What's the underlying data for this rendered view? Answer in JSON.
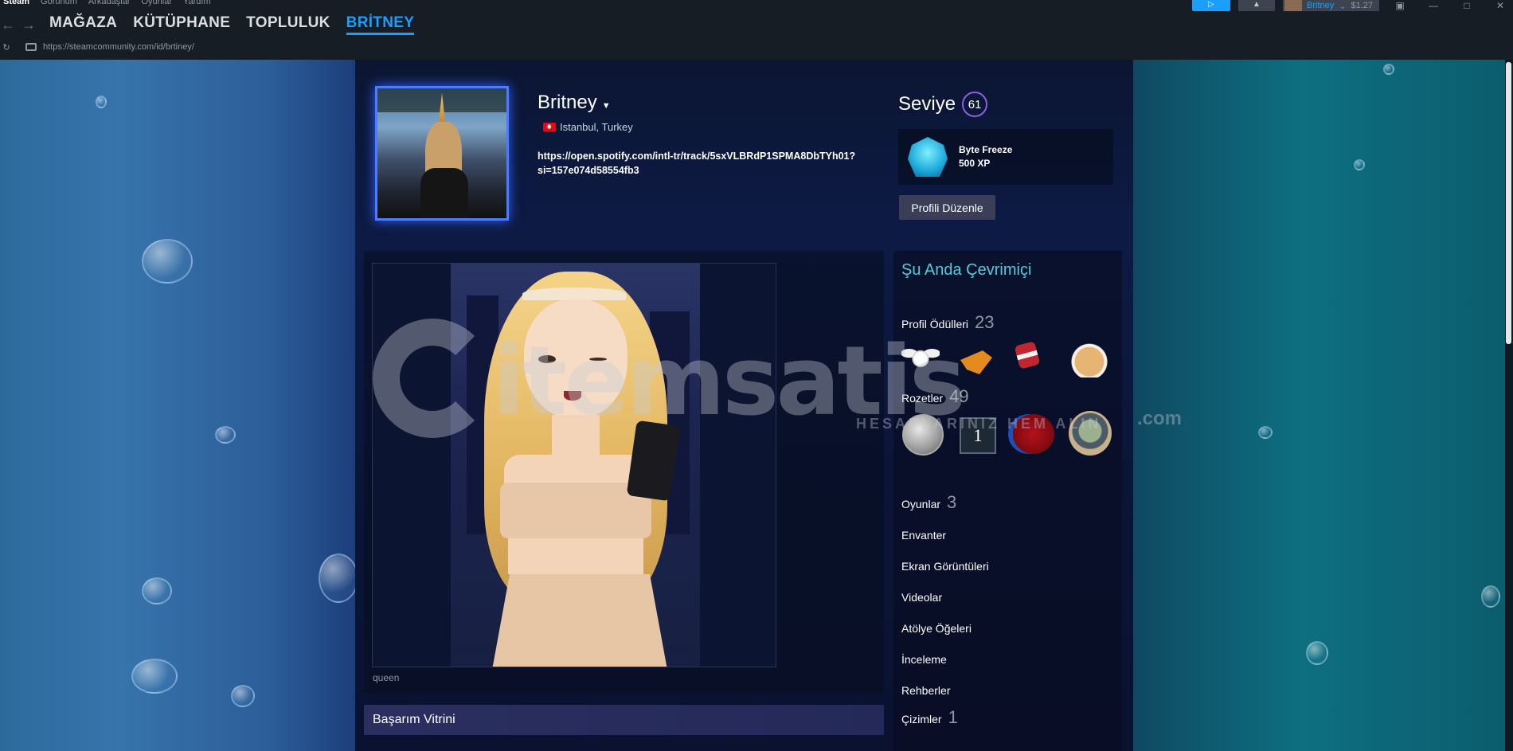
{
  "titlebar": {
    "menu": [
      "Steam",
      "Görünüm",
      "Arkadaşlar",
      "Oyunlar",
      "Yardım"
    ],
    "user_name": "Britney",
    "balance": "$1.27"
  },
  "nav": {
    "back": "←",
    "forward": "→",
    "links": [
      "MAĞAZA",
      "KÜTÜPHANE",
      "TOPLULUK",
      "BRİTNEY"
    ],
    "active_index": 3
  },
  "url": {
    "reload": "↻",
    "address": "https://steamcommunity.com/id/brtiney/"
  },
  "profile": {
    "persona_name": "Britney",
    "location": "Istanbul, Turkey",
    "summary": "https://open.spotify.com/intl-tr/track/5sxVLBRdP1SPMA8DbTYh01?si=157e074d58554fb3",
    "level_label": "Seviye",
    "level": "61",
    "badge_name": "Byte Freeze",
    "badge_xp": "500 XP",
    "edit_button": "Profili Düzenle"
  },
  "showcase": {
    "caption": "queen",
    "achievement_title": "Başarım Vitrini"
  },
  "sidebar": {
    "online_status": "Şu Anda Çevrimiçi",
    "awards_label": "Profil Ödülleri",
    "awards_count": "23",
    "badges_label": "Rozetler",
    "badges_count": "49",
    "badge_number": "1",
    "games_label": "Oyunlar",
    "games_count": "3",
    "inventory": "Envanter",
    "screenshots": "Ekran Görüntüleri",
    "videos": "Videolar",
    "workshop": "Atölye Öğeleri",
    "reviews": "İnceleme",
    "guides": "Rehberler",
    "artwork_label": "Çizimler",
    "artwork_count": "1"
  },
  "watermark": {
    "brand": "itemsatis",
    "tagline": "HESAPLARINIZ HEM ALIN",
    "tld": ".com"
  },
  "colors": {
    "accent": "#1a9fff",
    "online": "#57cbde",
    "level_ring": "#8a5fe0"
  }
}
